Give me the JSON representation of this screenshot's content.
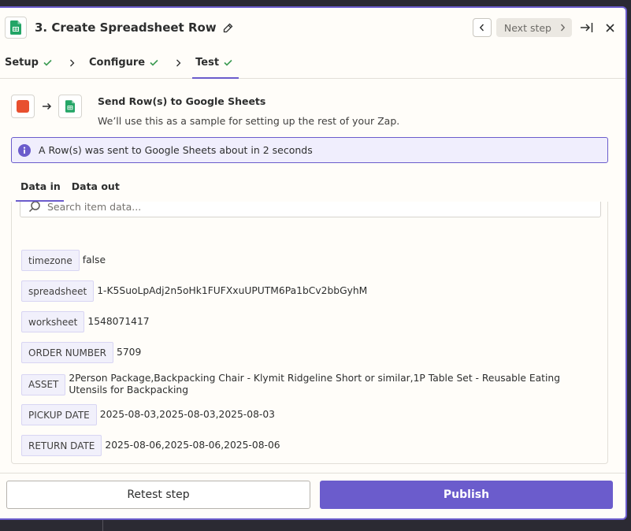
{
  "header": {
    "title": "3. Create Spreadsheet Row",
    "next_step_label": "Next step"
  },
  "steps": [
    {
      "label": "Setup"
    },
    {
      "label": "Configure"
    },
    {
      "label": "Test"
    }
  ],
  "summary": {
    "title": "Send Row(s) to Google Sheets",
    "subtitle": "We’ll use this as a sample for setting up the rest of your Zap."
  },
  "banner": {
    "text": "A Row(s) was sent to Google Sheets about in 2 seconds"
  },
  "data_tabs": [
    {
      "label": "Data in"
    },
    {
      "label": "Data out"
    }
  ],
  "search": {
    "placeholder": "Search item data..."
  },
  "fields": [
    {
      "key": "timezone",
      "value": "false"
    },
    {
      "key": "spreadsheet",
      "value": "1-K5SuoLpAdj2n5oHk1FUFXxuUPUTM6Pa1bCv2bbGyhM"
    },
    {
      "key": "worksheet",
      "value": "1548071417"
    },
    {
      "key": "ORDER NUMBER",
      "value": "5709"
    },
    {
      "key": "ASSET",
      "value": "2Person Package,Backpacking Chair - Klymit Ridgeline Short or similar,1P Table Set - Reusable Eating Utensils for Backpacking"
    },
    {
      "key": "PICKUP DATE",
      "value": "2025-08-03,2025-08-03,2025-08-03"
    },
    {
      "key": "RETURN DATE",
      "value": "2025-08-06,2025-08-06,2025-08-06"
    }
  ],
  "footer": {
    "retest_label": "Retest step",
    "publish_label": "Publish"
  },
  "colors": {
    "accent": "#6b5ccc",
    "check": "#3c9b53",
    "sheets_green": "#23a566",
    "trigger_red": "#e8502f"
  }
}
